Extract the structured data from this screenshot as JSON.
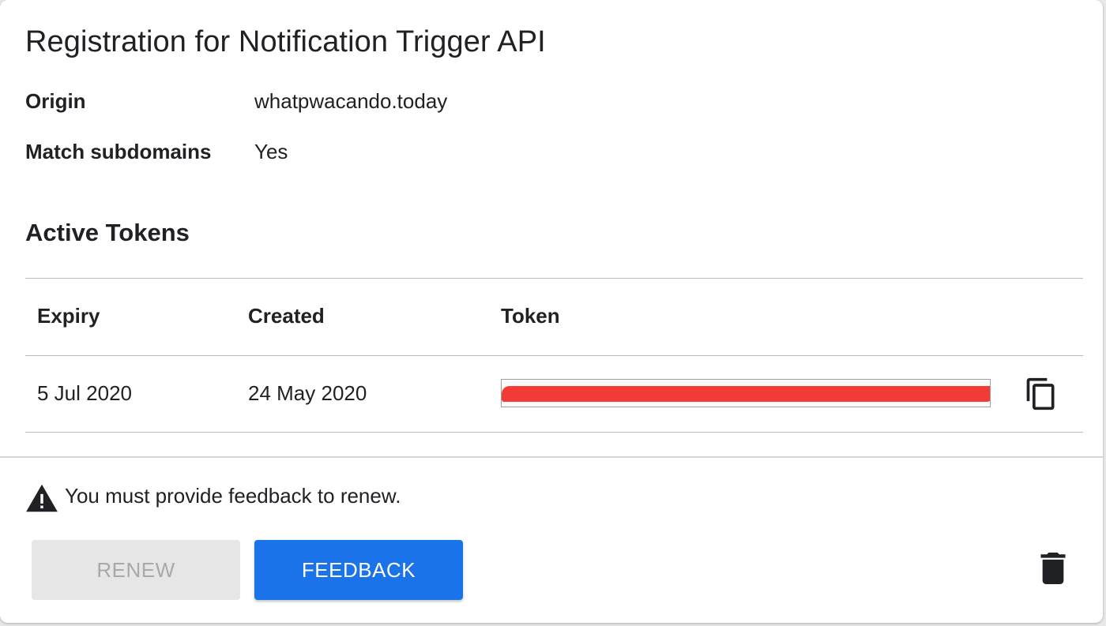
{
  "registration": {
    "title": "Registration for Notification Trigger API",
    "origin_label": "Origin",
    "origin_value": "whatpwacando.today",
    "subdomains_label": "Match subdomains",
    "subdomains_value": "Yes"
  },
  "tokens": {
    "section_title": "Active Tokens",
    "columns": [
      "Expiry",
      "Created",
      "Token"
    ],
    "rows": [
      {
        "expiry": "5 Jul 2020",
        "created": "24 May 2020",
        "token_redacted": true,
        "copy_icon": "copy-icon"
      }
    ]
  },
  "footer": {
    "warning_icon": "warning-icon",
    "warning_text": "You must provide feedback to renew.",
    "renew_label": "RENEW",
    "renew_disabled": true,
    "feedback_label": "FEEDBACK",
    "delete_icon": "trash-icon"
  },
  "colors": {
    "primary": "#1a73e8",
    "disabled_bg": "#e6e6e6",
    "disabled_text": "#a9a9a9",
    "redaction": "#f23a37",
    "text": "#202124"
  }
}
